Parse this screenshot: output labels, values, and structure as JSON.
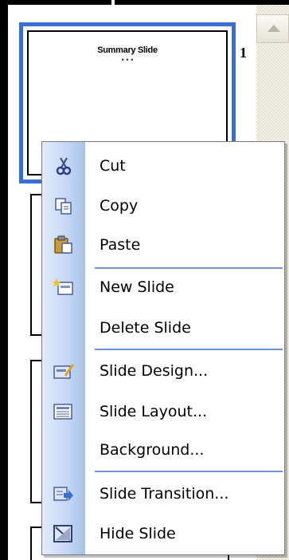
{
  "thumbnail_pane": {
    "selected_slide": {
      "number": "1",
      "title": "Summary Slide",
      "dots": "• • •"
    }
  },
  "context_menu": {
    "items": [
      {
        "label": "Cut",
        "icon": "scissors-icon"
      },
      {
        "label": "Copy",
        "icon": "copy-icon"
      },
      {
        "label": "Paste",
        "icon": "clipboard-paste-icon"
      },
      {
        "label": "New Slide",
        "icon": "new-slide-icon"
      },
      {
        "label": "Delete Slide",
        "icon": ""
      },
      {
        "label": "Slide Design...",
        "icon": "slide-design-icon"
      },
      {
        "label": "Slide Layout...",
        "icon": "slide-layout-icon"
      },
      {
        "label": "Background...",
        "icon": ""
      },
      {
        "label": "Slide Transition...",
        "icon": "slide-transition-icon"
      },
      {
        "label": "Hide Slide",
        "icon": "hide-slide-icon"
      }
    ]
  },
  "colors": {
    "selection_border": "#3a6fd0",
    "separator": "#6f8fd6",
    "menu_gutter": "#c3d6f4"
  }
}
